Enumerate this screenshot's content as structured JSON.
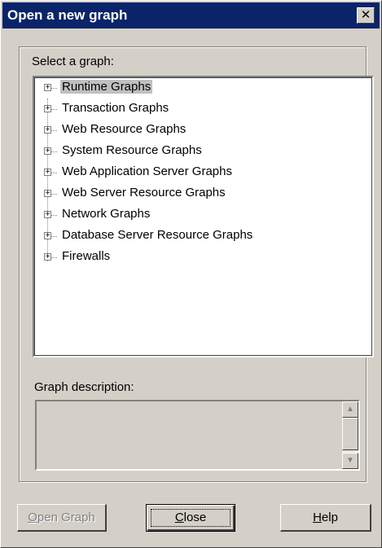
{
  "window": {
    "title": "Open a new graph",
    "close_glyph": "✕"
  },
  "labels": {
    "select_graph": "Select a graph:",
    "graph_description": "Graph description:"
  },
  "tree": {
    "items": [
      {
        "label": "Runtime Graphs",
        "selected": true
      },
      {
        "label": "Transaction Graphs"
      },
      {
        "label": "Web Resource Graphs"
      },
      {
        "label": "System Resource Graphs"
      },
      {
        "label": "Web Application Server Graphs"
      },
      {
        "label": "Web Server Resource Graphs"
      },
      {
        "label": "Network Graphs"
      },
      {
        "label": "Database Server Resource Graphs"
      },
      {
        "label": "Firewalls"
      }
    ],
    "expander_glyph": "+"
  },
  "description": {
    "text": "",
    "scroll_up_glyph": "▲",
    "scroll_down_glyph": "▼"
  },
  "buttons": {
    "open_graph": {
      "mnemonic": "O",
      "rest": "pen Graph",
      "enabled": false
    },
    "close": {
      "mnemonic": "C",
      "rest": "lose"
    },
    "help": {
      "mnemonic": "H",
      "rest": "elp"
    }
  }
}
